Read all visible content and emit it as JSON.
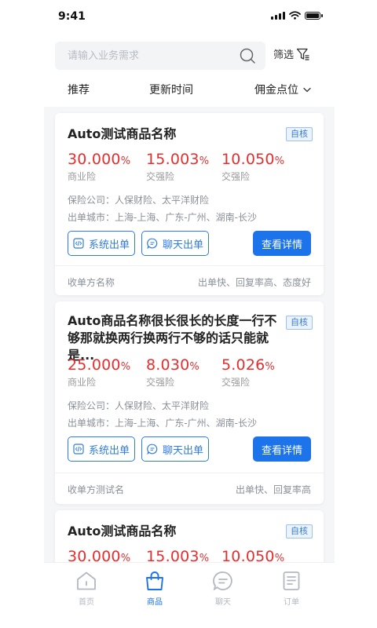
{
  "status": {
    "time": "9:41"
  },
  "search": {
    "placeholder": "请输入业务需求",
    "filter_label": "筛选"
  },
  "sort": {
    "recommend": "推荐",
    "update_time": "更新时间",
    "commission": "佣金点位"
  },
  "cards": [
    {
      "title": "Auto测试商品名称",
      "tag": "自核",
      "rates": [
        {
          "value": "30.000",
          "unit": "%",
          "label": "商业险"
        },
        {
          "value": "15.003",
          "unit": "%",
          "label": "交强险"
        },
        {
          "value": "10.050",
          "unit": "%",
          "label": "交强险"
        }
      ],
      "company": "保险公司：人保财险、太平洋财险",
      "city": "出单城市：上海-上海、广东-广州、湖南-长沙",
      "btn_system": "系统出单",
      "btn_chat": "聊天出单",
      "btn_detail": "查看详情",
      "footer_left": "收单方名称",
      "footer_right": "出单快、回复率高、态度好"
    },
    {
      "title": "Auto商品名称很长很长的长度一行不够那就换两行换两行不够的话只能就是...",
      "tag": "自核",
      "rates": [
        {
          "value": "25.000",
          "unit": "%",
          "label": "商业险"
        },
        {
          "value": "8.030",
          "unit": "%",
          "label": "交强险"
        },
        {
          "value": "5.026",
          "unit": "%",
          "label": "交强险"
        }
      ],
      "company": "保险公司：人保财险、太平洋财险",
      "city": "出单城市：上海-上海、广东-广州、湖南-长沙",
      "btn_system": "系统出单",
      "btn_chat": "聊天出单",
      "btn_detail": "查看详情",
      "footer_left": "收单方测试名",
      "footer_right": "出单快、回复率高"
    },
    {
      "title": "Auto测试商品名称",
      "tag": "自核",
      "rates": [
        {
          "value": "30.000",
          "unit": "%"
        },
        {
          "value": "15.003",
          "unit": "%"
        },
        {
          "value": "10.050",
          "unit": "%"
        }
      ]
    }
  ],
  "tabs": [
    {
      "label": "首页",
      "icon": "home-icon",
      "active": false
    },
    {
      "label": "商品",
      "icon": "shopping-bag-icon",
      "active": true
    },
    {
      "label": "聊天",
      "icon": "chat-icon",
      "active": false
    },
    {
      "label": "订单",
      "icon": "order-icon",
      "active": false
    }
  ],
  "colors": {
    "accent": "#1d74ea",
    "rate": "#e62e2e",
    "tag_bg": "#eaf3fe"
  }
}
